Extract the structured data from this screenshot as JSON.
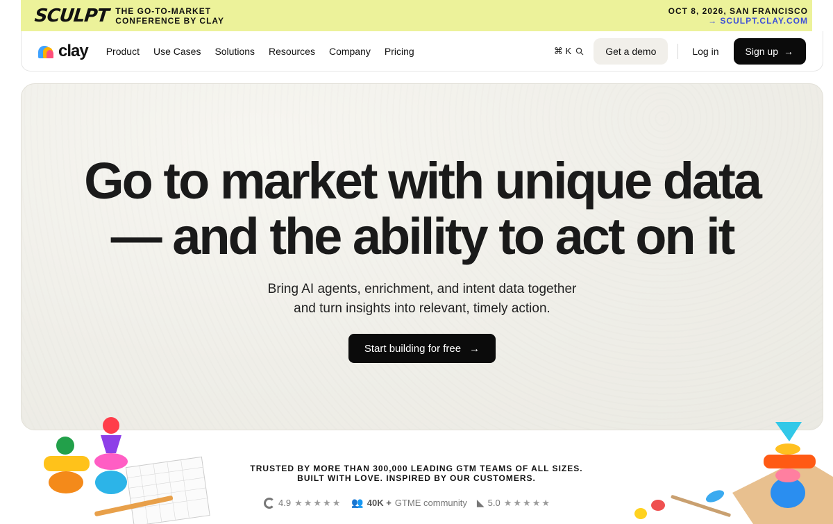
{
  "banner": {
    "brand": "SCULPT",
    "tag_line1": "THE GO-TO-MARKET",
    "tag_line2": "CONFERENCE BY CLAY",
    "date_location": "OCT 8, 2026, SAN FRANCISCO",
    "link": "→ SCULPT.CLAY.COM"
  },
  "nav": {
    "logo_text": "clay",
    "menu": [
      "Product",
      "Use Cases",
      "Solutions",
      "Resources",
      "Company",
      "Pricing"
    ],
    "shortcut": "⌘ K",
    "demo_label": "Get a demo",
    "login_label": "Log in",
    "signup_label": "Sign up"
  },
  "hero": {
    "headline_line1": "Go to market with unique data",
    "headline_line2": "— and the ability to act on it",
    "sub_line1": "Bring AI agents, enrichment, and intent data together",
    "sub_line2": "and turn insights into relevant, timely action.",
    "cta_label": "Start building for free"
  },
  "trust": {
    "line1": "TRUSTED BY MORE THAN 300,000 LEADING GTM TEAMS OF ALL SIZES.",
    "line2": "BUILT WITH LOVE. INSPIRED BY OUR CUSTOMERS.",
    "g2_rating": "4.9",
    "community_count": "40K +",
    "community_label": "GTME community",
    "capterra_rating": "5.0",
    "stars": "★★★★★"
  },
  "colors": {
    "banner_bg": "#ecf29a",
    "banner_link": "#3d4fd8",
    "button_dark": "#0b0b0b"
  }
}
